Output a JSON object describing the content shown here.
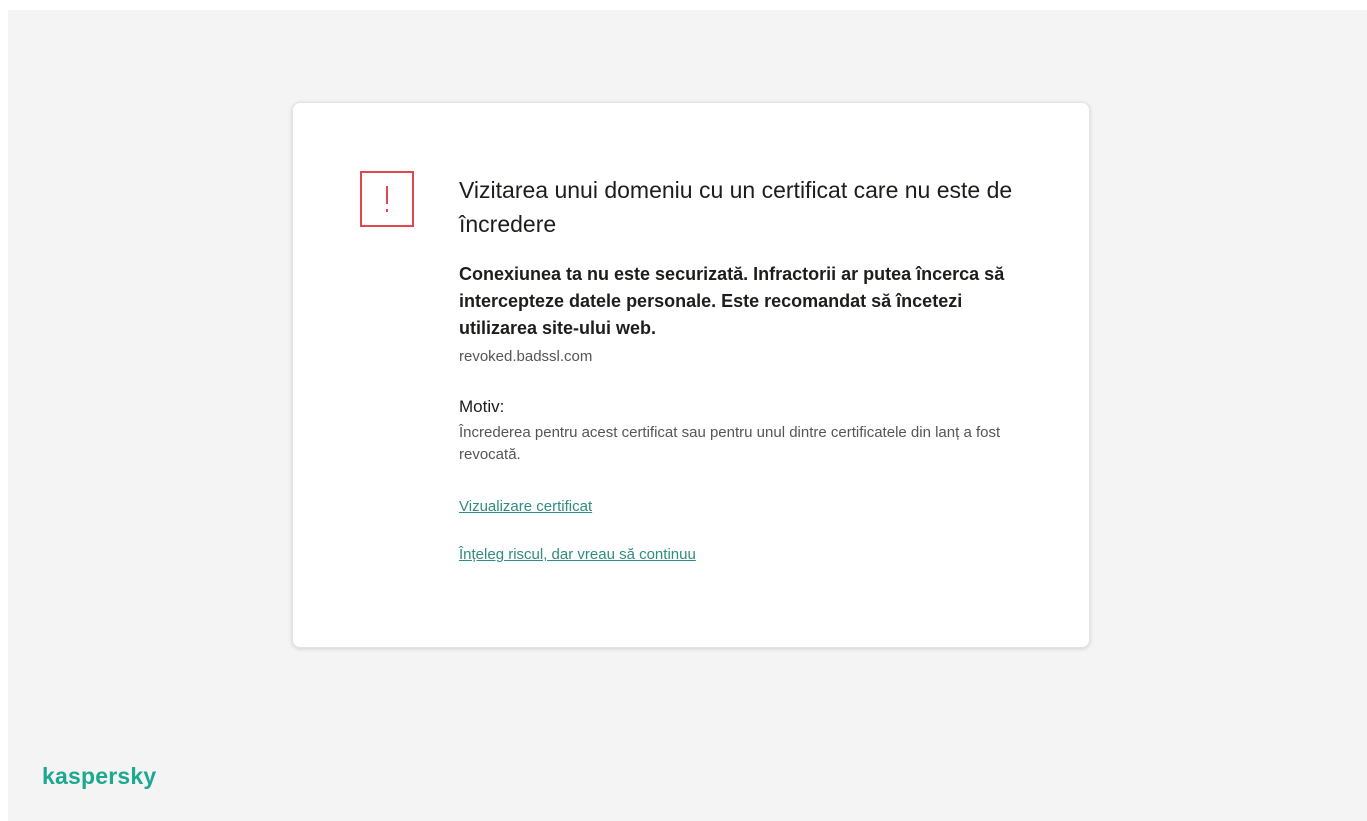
{
  "colors": {
    "background": "#f4f4f4",
    "card": "#ffffff",
    "warning": "#e0474f",
    "link": "#2f8c80",
    "brand": "#1ea88f"
  },
  "warning": {
    "icon": "exclamation-square-icon",
    "title": "Vizitarea unui domeniu cu un certificat care nu este de încredere",
    "description": "Conexiunea ta nu este securizată. Infractorii ar putea încerca să intercepteze datele personale. Este recomandat să încetezi utilizarea site-ului web.",
    "domain": "revoked.badssl.com",
    "reason_label": "Motiv:",
    "reason_text": "Încrederea pentru acest certificat sau pentru unul dintre certificatele din lanț a fost revocată.",
    "view_certificate_link": "Vizualizare certificat",
    "proceed_link": "Înțeleg riscul, dar vreau să continuu"
  },
  "brand": {
    "logo_text": "kaspersky"
  }
}
